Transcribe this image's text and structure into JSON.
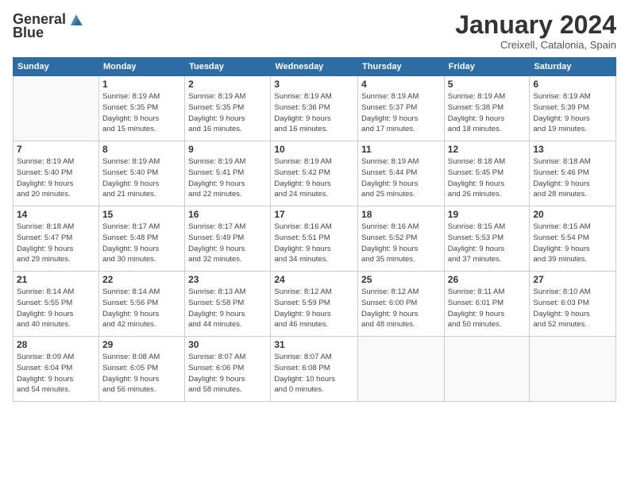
{
  "logo": {
    "text1": "General",
    "text2": "Blue"
  },
  "title": "January 2024",
  "subtitle": "Creixell, Catalonia, Spain",
  "weekdays": [
    "Sunday",
    "Monday",
    "Tuesday",
    "Wednesday",
    "Thursday",
    "Friday",
    "Saturday"
  ],
  "weeks": [
    [
      {
        "day": "",
        "info": ""
      },
      {
        "day": "1",
        "info": "Sunrise: 8:19 AM\nSunset: 5:35 PM\nDaylight: 9 hours\nand 15 minutes."
      },
      {
        "day": "2",
        "info": "Sunrise: 8:19 AM\nSunset: 5:35 PM\nDaylight: 9 hours\nand 16 minutes."
      },
      {
        "day": "3",
        "info": "Sunrise: 8:19 AM\nSunset: 5:36 PM\nDaylight: 9 hours\nand 16 minutes."
      },
      {
        "day": "4",
        "info": "Sunrise: 8:19 AM\nSunset: 5:37 PM\nDaylight: 9 hours\nand 17 minutes."
      },
      {
        "day": "5",
        "info": "Sunrise: 8:19 AM\nSunset: 5:38 PM\nDaylight: 9 hours\nand 18 minutes."
      },
      {
        "day": "6",
        "info": "Sunrise: 8:19 AM\nSunset: 5:39 PM\nDaylight: 9 hours\nand 19 minutes."
      }
    ],
    [
      {
        "day": "7",
        "info": ""
      },
      {
        "day": "8",
        "info": "Sunrise: 8:19 AM\nSunset: 5:40 PM\nDaylight: 9 hours\nand 21 minutes."
      },
      {
        "day": "9",
        "info": "Sunrise: 8:19 AM\nSunset: 5:41 PM\nDaylight: 9 hours\nand 22 minutes."
      },
      {
        "day": "10",
        "info": "Sunrise: 8:19 AM\nSunset: 5:42 PM\nDaylight: 9 hours\nand 24 minutes."
      },
      {
        "day": "11",
        "info": "Sunrise: 8:19 AM\nSunset: 5:44 PM\nDaylight: 9 hours\nand 25 minutes."
      },
      {
        "day": "12",
        "info": "Sunrise: 8:18 AM\nSunset: 5:45 PM\nDaylight: 9 hours\nand 26 minutes."
      },
      {
        "day": "13",
        "info": "Sunrise: 8:18 AM\nSunset: 5:46 PM\nDaylight: 9 hours\nand 28 minutes."
      }
    ],
    [
      {
        "day": "14",
        "info": ""
      },
      {
        "day": "15",
        "info": "Sunrise: 8:17 AM\nSunset: 5:48 PM\nDaylight: 9 hours\nand 30 minutes."
      },
      {
        "day": "16",
        "info": "Sunrise: 8:17 AM\nSunset: 5:49 PM\nDaylight: 9 hours\nand 32 minutes."
      },
      {
        "day": "17",
        "info": "Sunrise: 8:16 AM\nSunset: 5:51 PM\nDaylight: 9 hours\nand 34 minutes."
      },
      {
        "day": "18",
        "info": "Sunrise: 8:16 AM\nSunset: 5:52 PM\nDaylight: 9 hours\nand 35 minutes."
      },
      {
        "day": "19",
        "info": "Sunrise: 8:15 AM\nSunset: 5:53 PM\nDaylight: 9 hours\nand 37 minutes."
      },
      {
        "day": "20",
        "info": "Sunrise: 8:15 AM\nSunset: 5:54 PM\nDaylight: 9 hours\nand 39 minutes."
      }
    ],
    [
      {
        "day": "21",
        "info": ""
      },
      {
        "day": "22",
        "info": "Sunrise: 8:14 AM\nSunset: 5:56 PM\nDaylight: 9 hours\nand 42 minutes."
      },
      {
        "day": "23",
        "info": "Sunrise: 8:13 AM\nSunset: 5:58 PM\nDaylight: 9 hours\nand 44 minutes."
      },
      {
        "day": "24",
        "info": "Sunrise: 8:12 AM\nSunset: 5:59 PM\nDaylight: 9 hours\nand 46 minutes."
      },
      {
        "day": "25",
        "info": "Sunrise: 8:12 AM\nSunset: 6:00 PM\nDaylight: 9 hours\nand 48 minutes."
      },
      {
        "day": "26",
        "info": "Sunrise: 8:11 AM\nSunset: 6:01 PM\nDaylight: 9 hours\nand 50 minutes."
      },
      {
        "day": "27",
        "info": "Sunrise: 8:10 AM\nSunset: 6:03 PM\nDaylight: 9 hours\nand 52 minutes."
      }
    ],
    [
      {
        "day": "28",
        "info": "Sunrise: 8:09 AM\nSunset: 6:04 PM\nDaylight: 9 hours\nand 54 minutes."
      },
      {
        "day": "29",
        "info": "Sunrise: 8:08 AM\nSunset: 6:05 PM\nDaylight: 9 hours\nand 56 minutes."
      },
      {
        "day": "30",
        "info": "Sunrise: 8:07 AM\nSunset: 6:06 PM\nDaylight: 9 hours\nand 58 minutes."
      },
      {
        "day": "31",
        "info": "Sunrise: 8:07 AM\nSunset: 6:08 PM\nDaylight: 10 hours\nand 0 minutes."
      },
      {
        "day": "",
        "info": ""
      },
      {
        "day": "",
        "info": ""
      },
      {
        "day": "",
        "info": ""
      }
    ]
  ],
  "week7_sun": {
    "day": "7",
    "info": "Sunrise: 8:19 AM\nSunset: 5:40 PM\nDaylight: 9 hours\nand 20 minutes."
  },
  "week14_sun": {
    "day": "14",
    "info": "Sunrise: 8:18 AM\nSunset: 5:47 PM\nDaylight: 9 hours\nand 29 minutes."
  },
  "week21_sun": {
    "day": "21",
    "info": "Sunrise: 8:14 AM\nSunset: 5:55 PM\nDaylight: 9 hours\nand 40 minutes."
  }
}
